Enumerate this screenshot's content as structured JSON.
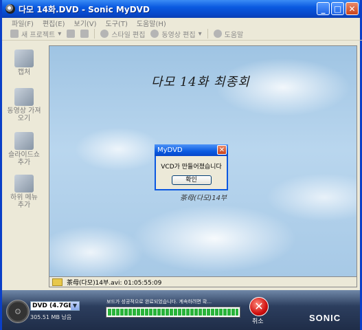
{
  "window": {
    "title": "다모 14화.DVD - Sonic MyDVD",
    "minimize": "_",
    "maximize": "□",
    "close": "✕"
  },
  "menu": {
    "items": [
      "파일(F)",
      "편집(E)",
      "보기(V)",
      "도구(T)",
      "도움말(H)"
    ]
  },
  "toolbar": {
    "new_project": "새 프로젝트",
    "edit_style": "스타일 편집",
    "edit_movie": "동영상 편집",
    "help": "도움말"
  },
  "sidebar": {
    "items": [
      {
        "label": "캡처",
        "icon": "camera-icon"
      },
      {
        "label": "동영상 가져오기",
        "icon": "film-import-icon"
      },
      {
        "label": "슬라이드쇼 추가",
        "icon": "slideshow-icon"
      },
      {
        "label": "하위 메뉴 추가",
        "icon": "submenu-icon"
      }
    ]
  },
  "preview": {
    "disc_title": "다모 14화 최종회",
    "menu_item": "茶母(다모)14부"
  },
  "dialog": {
    "title": "MyDVD",
    "message": "VCD가 만들어졌습니다",
    "ok": "확인",
    "close": "✕"
  },
  "status": {
    "file": "茶母(다모)14부.avi: 01:05:55:09"
  },
  "bottom": {
    "disc_type": "DVD (4.7GB)",
    "space": "305.51 MB 남음",
    "progress_text": "보드가 성공적으로 완료되었습니다. 계속하려면 확...",
    "progress": 1.0,
    "cancel": "취소",
    "logo": "SONIC"
  }
}
